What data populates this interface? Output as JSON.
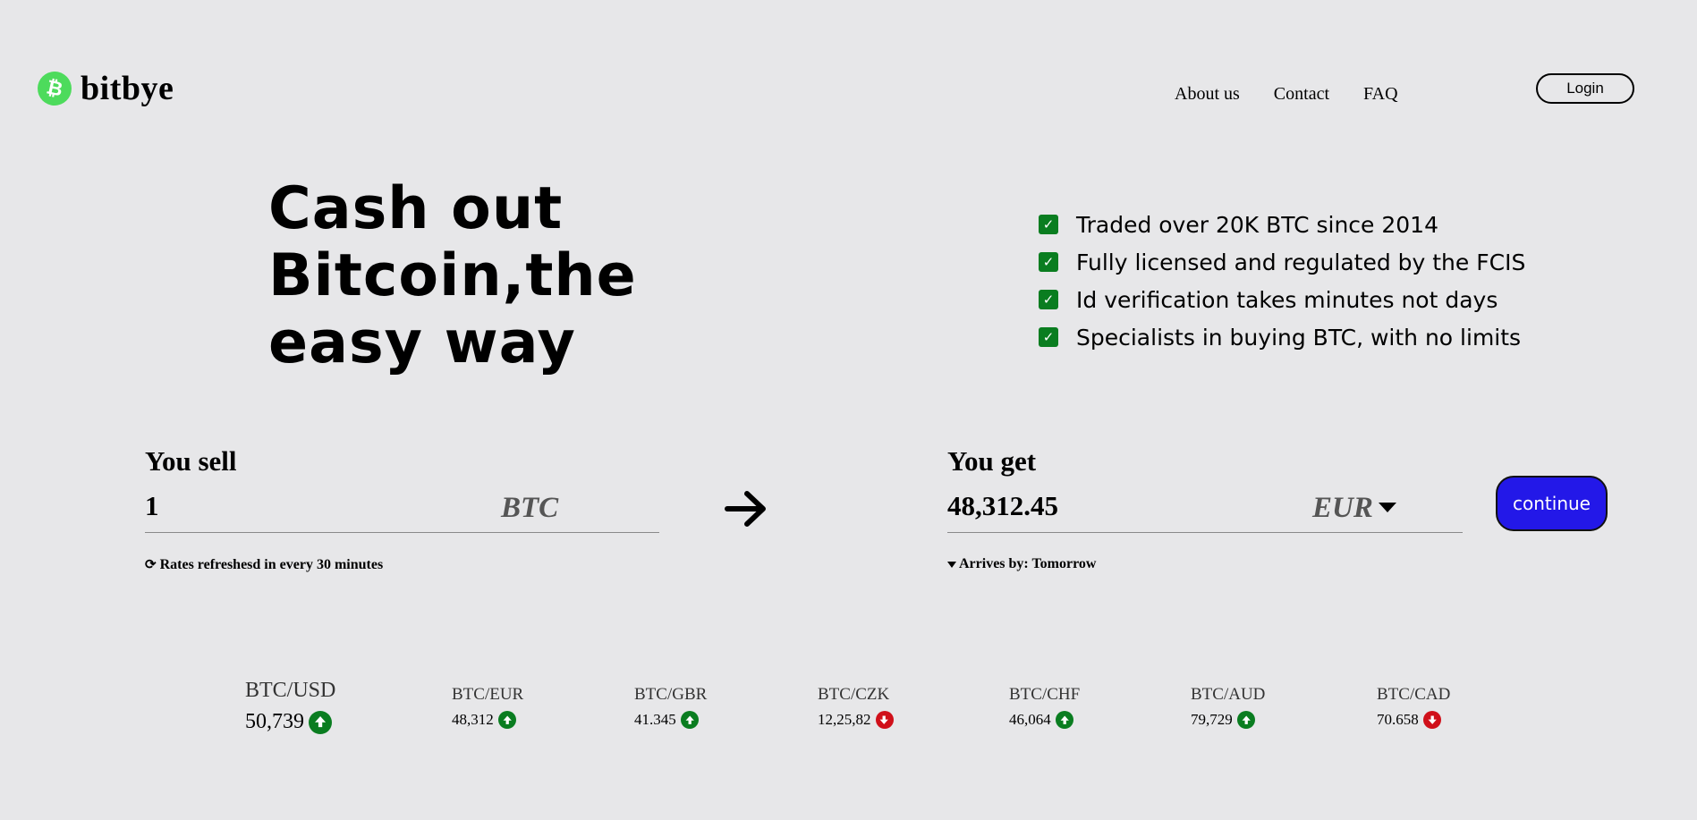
{
  "brand": {
    "name": "bitbye",
    "logo_icon": "bitcoin-icon",
    "logo_color": "#4ddb5c"
  },
  "nav": {
    "items": [
      "About us",
      "Contact",
      "FAQ"
    ],
    "login_label": "Login"
  },
  "hero": {
    "title_lines": [
      "Cash out",
      "Bitcoin,the",
      "easy way"
    ],
    "features": [
      "Traded over 20K BTC since 2014",
      "Fully licensed and regulated by the FCIS",
      "Id verification takes minutes not days",
      "Specialists in buying BTC, with no limits"
    ],
    "check_color": "#0a7d20"
  },
  "converter": {
    "sell_label": "You sell",
    "sell_value": "1",
    "sell_currency": "BTC",
    "get_label": "You get",
    "get_value": "48,312.45",
    "get_currency": "EUR",
    "continue_label": "continue",
    "continue_color": "#2318e8",
    "rates_note": "Rates refreshesd in every 30 minutes",
    "arrival_note": "Arrives by: Tomorrow"
  },
  "rates": [
    {
      "pair": "BTC/USD",
      "value": "50,739",
      "trend": "up"
    },
    {
      "pair": "BTC/EUR",
      "value": "48,312",
      "trend": "up"
    },
    {
      "pair": "BTC/GBR",
      "value": "41.345",
      "trend": "up"
    },
    {
      "pair": "BTC/CZK",
      "value": "12,25,82",
      "trend": "down"
    },
    {
      "pair": "BTC/CHF",
      "value": "46,064",
      "trend": "up"
    },
    {
      "pair": "BTC/AUD",
      "value": "79,729",
      "trend": "up"
    },
    {
      "pair": "BTC/CAD",
      "value": "70.658",
      "trend": "down"
    }
  ],
  "trend_colors": {
    "up": "#0a7d20",
    "down": "#d0101a"
  }
}
